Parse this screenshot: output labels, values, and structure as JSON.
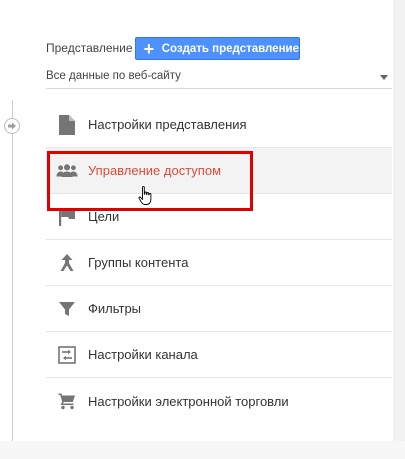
{
  "header": {
    "view_label": "Представление",
    "create_button": {
      "icon": "plus-icon",
      "label": "Создать представление"
    }
  },
  "view_select": {
    "value": "Все данные по веб-сайту"
  },
  "menu": {
    "items": [
      {
        "label": "Настройки представления",
        "icon": "document-icon"
      },
      {
        "label": "Управление доступом",
        "icon": "users-icon",
        "active": true
      },
      {
        "label": "Цели",
        "icon": "flag-icon"
      },
      {
        "label": "Группы контента",
        "icon": "content-groups-icon"
      },
      {
        "label": "Фильтры",
        "icon": "filter-icon"
      },
      {
        "label": "Настройки канала",
        "icon": "channel-settings-icon"
      },
      {
        "label": "Настройки электронной торговли",
        "icon": "cart-icon"
      }
    ]
  },
  "colors": {
    "button_blue": "#4d90fe",
    "active_text": "#dd4b39",
    "highlight_border": "#e00000",
    "icon_gray": "#757575"
  }
}
